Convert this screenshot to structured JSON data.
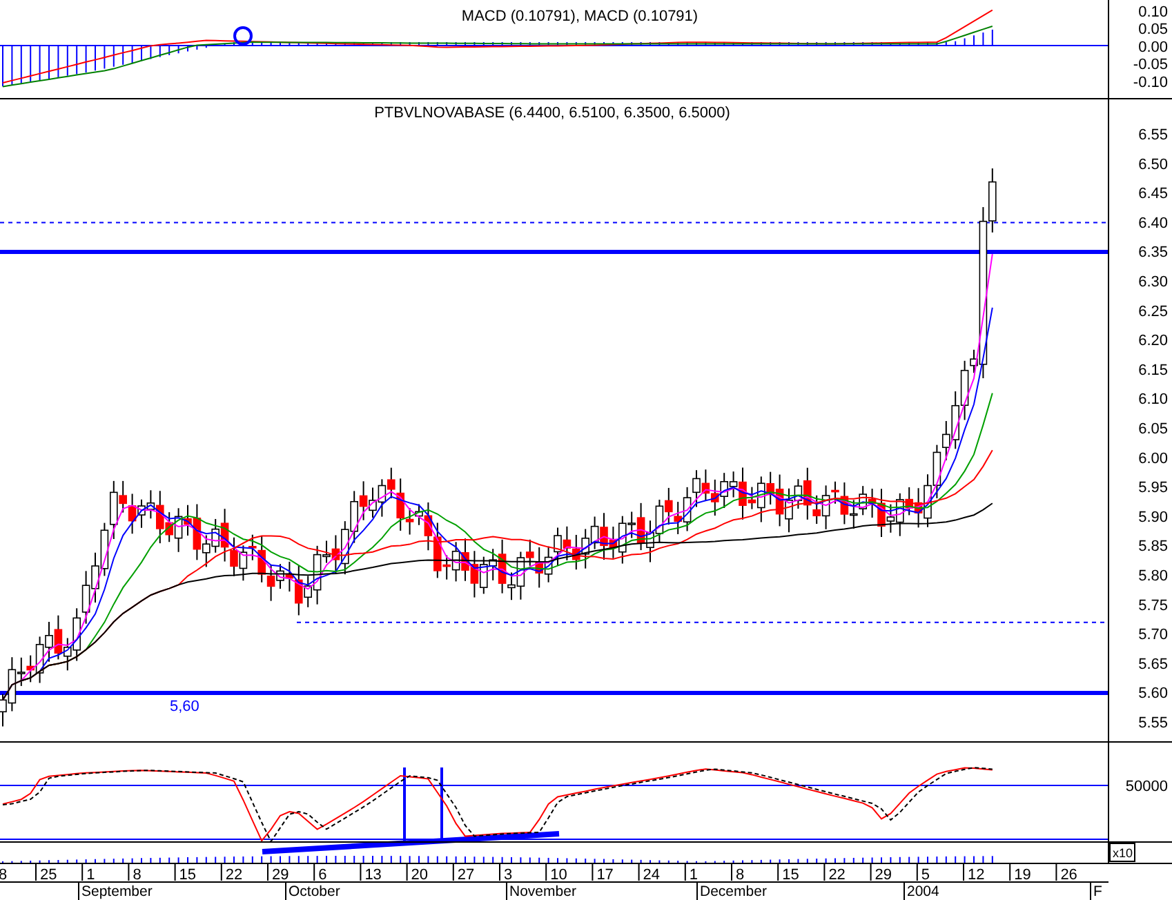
{
  "macd_panel": {
    "title": "MACD (0.10791), MACD (0.10791)",
    "axis_labels": [
      "0.10",
      "0.05",
      "0.00",
      "-0.05",
      "-0.10"
    ]
  },
  "price_panel": {
    "title": "PTBVLNOVABASE (6.4400, 6.5100, 6.3500, 6.5000)",
    "axis_labels": [
      "6.55",
      "6.50",
      "6.45",
      "6.40",
      "6.35",
      "6.30",
      "6.25",
      "6.20",
      "6.15",
      "6.10",
      "6.05",
      "6.00",
      "5.95",
      "5.90",
      "5.85",
      "5.80",
      "5.75",
      "5.70",
      "5.65",
      "5.60",
      "5.55"
    ],
    "annotation": "5,60"
  },
  "oscillator_panel": {
    "axis_label": "50000",
    "scale_label": "x10"
  },
  "date_axis": {
    "days": [
      "8",
      "25",
      "1",
      "8",
      "15",
      "22",
      "29",
      "6",
      "13",
      "20",
      "27",
      "3",
      "10",
      "17",
      "24",
      "1",
      "8",
      "15",
      "22",
      "29",
      "5",
      "12",
      "19",
      "26"
    ],
    "months": [
      "September",
      "October",
      "November",
      "December",
      "2004",
      "F"
    ]
  }
}
